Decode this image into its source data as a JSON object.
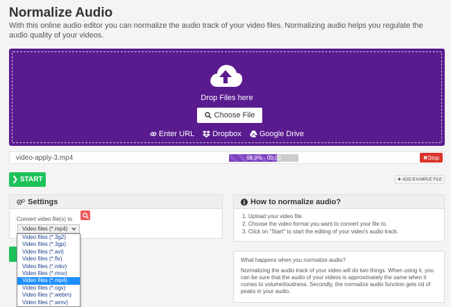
{
  "page": {
    "title": "Normalize Audio",
    "intro": "With this online audio editor you can normalize the audio track of your video files. Normalizing audio helps you regulate the audio quality of your videos."
  },
  "upload": {
    "drop_text": "Drop Files here",
    "choose_label": "Choose File",
    "sources": {
      "url": "Enter URL",
      "dropbox": "Dropbox",
      "gdrive": "Google Drive"
    },
    "accent_color": "#5a1b8f"
  },
  "file": {
    "name": "video-apply-3.mp4",
    "progress_percent": 68.9,
    "progress_text": "68.9% - 00:00",
    "stop_label": "Stop"
  },
  "actions": {
    "start_label": "START",
    "add_example_label": "ADD EXAMPLE FILE"
  },
  "settings": {
    "heading": "Settings",
    "convert_label": "Convert video file(s) to",
    "selected_format": "Video files (*.mp4)",
    "options": [
      "Video files (*.3g2)",
      "Video files (*.3gp)",
      "Video files (*.avi)",
      "Video files (*.flv)",
      "Video files (*.mkv)",
      "Video files (*.mov)",
      "Video files (*.mp4)",
      "Video files (*.ogv)",
      "Video files (*.webm)",
      "Video files (*.wmv)"
    ],
    "selected_index": 6
  },
  "howto": {
    "heading": "How to normalize audio?",
    "steps": [
      "1. Upload your video file.",
      "2. Choose the video format you want to convert your file to.",
      "3. Click on \"Start\" to start the editing of your video's audio track."
    ]
  },
  "what": {
    "question": "What happens when you normalize audio?",
    "answer": "Normalizing the audio track of your video will do two things. When using it, you can be sure that the audio of your videos is approximately the same when it comes to volume/loudness. Secondly, the normalize audio function gets rid of peaks in your audio."
  },
  "colors": {
    "start": "#1ec25a",
    "stop": "#d9342b",
    "selected_option": "#1e90ff"
  }
}
